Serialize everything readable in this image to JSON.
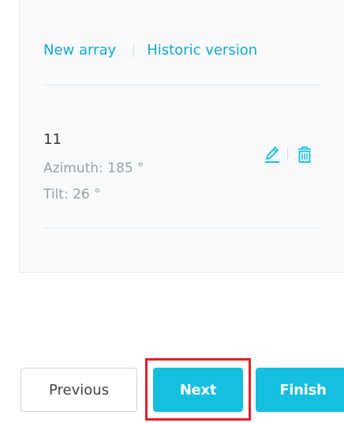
{
  "tabs": {
    "new_array": "New array",
    "historic_version": "Historic version"
  },
  "array": {
    "name": "11",
    "azimuth": "Azimuth:  185 °",
    "tilt": "Tilt:  26 °",
    "edit_icon": "pencil-icon",
    "delete_icon": "trash-icon"
  },
  "buttons": {
    "previous": "Previous",
    "next": "Next",
    "finish": "Finish"
  },
  "colors": {
    "accent": "#16bfdf",
    "link": "#13a8d0",
    "highlight": "#e21f2a"
  }
}
